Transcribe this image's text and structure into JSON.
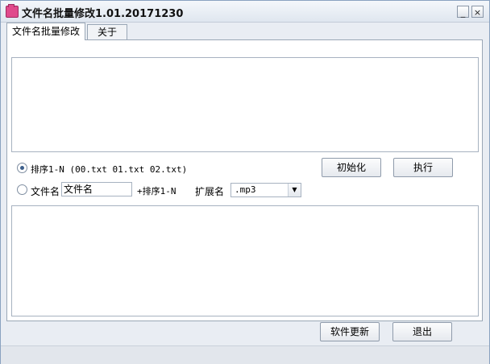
{
  "window": {
    "title": "文件名批量修改1.01.20171230",
    "minimize_symbol": "_",
    "close_symbol": "×"
  },
  "tabs": [
    {
      "label": "文件名批量修改",
      "active": true
    },
    {
      "label": "关于",
      "active": false
    }
  ],
  "options": {
    "sort_option_label": "排序1-N (00.txt  01.txt 02.txt)",
    "sort_option_checked": true,
    "filename_option_label": "文件名",
    "filename_option_checked": false,
    "filename_value": "文件名",
    "suffix_label": "+排序1-N",
    "extension_label": "扩展名",
    "extension_value": ".mp3"
  },
  "buttons": {
    "init": "初始化",
    "execute": "执行",
    "update": "软件更新",
    "exit": "退出"
  }
}
